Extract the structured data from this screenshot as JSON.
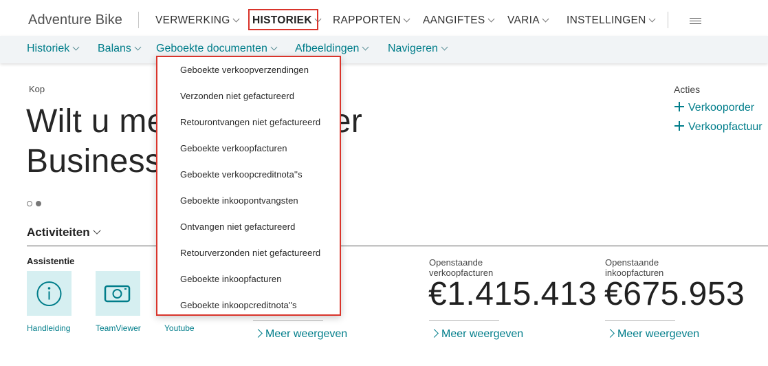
{
  "app": {
    "name": "Adventure Bike"
  },
  "topnav": [
    {
      "label": "VERWERKING"
    },
    {
      "label": "HISTORIEK"
    },
    {
      "label": "RAPPORTEN"
    },
    {
      "label": "AANGIFTES"
    },
    {
      "label": "VARIA"
    },
    {
      "label": "INSTELLINGEN"
    }
  ],
  "subnav": [
    {
      "label": "Historiek"
    },
    {
      "label": "Balans"
    },
    {
      "label": "Geboekte documenten"
    },
    {
      "label": "Afbeeldingen"
    },
    {
      "label": "Navigeren"
    }
  ],
  "dropdown": {
    "items": [
      "Geboekte verkoopverzendingen",
      "Verzonden niet gefactureerd",
      "Retourontvangen niet gefactureerd",
      "Geboekte verkoopfacturen",
      "Geboekte verkoopcreditnota''s",
      "Geboekte inkoopontvangsten",
      "Ontvangen niet gefactureerd",
      "Retourverzonden niet gefactureerd",
      "Geboekte inkoopfacturen",
      "Geboekte inkoopcreditnota''s"
    ]
  },
  "headline": {
    "kop": "Kop",
    "line1_start": "Wilt u me",
    "line1_end": "er",
    "line2": "Business"
  },
  "acties": {
    "title": "Acties",
    "items": [
      "Verkooporder",
      "Verkoopfactuur"
    ]
  },
  "activiteiten": {
    "title": "Activiteiten",
    "assistentie": "Assistentie",
    "tiles": [
      {
        "label": "Handleiding",
        "icon": "info-icon"
      },
      {
        "label": "TeamViewer",
        "icon": "camera-icon"
      },
      {
        "label": "Youtube",
        "icon": ""
      }
    ],
    "kpis": [
      {
        "label": "",
        "value": "",
        "more": "Meer weergeven"
      },
      {
        "label": "Openstaande verkoopfacturen",
        "value": "€1.415.413",
        "more": "Meer weergeven"
      },
      {
        "label": "Openstaande inkoopfacturen",
        "value": "€675.953",
        "more": "Meer weergeven"
      }
    ]
  },
  "colors": {
    "accent": "#007d8a",
    "highlight": "#d9342b",
    "tile_bg": "#d6eff1"
  }
}
